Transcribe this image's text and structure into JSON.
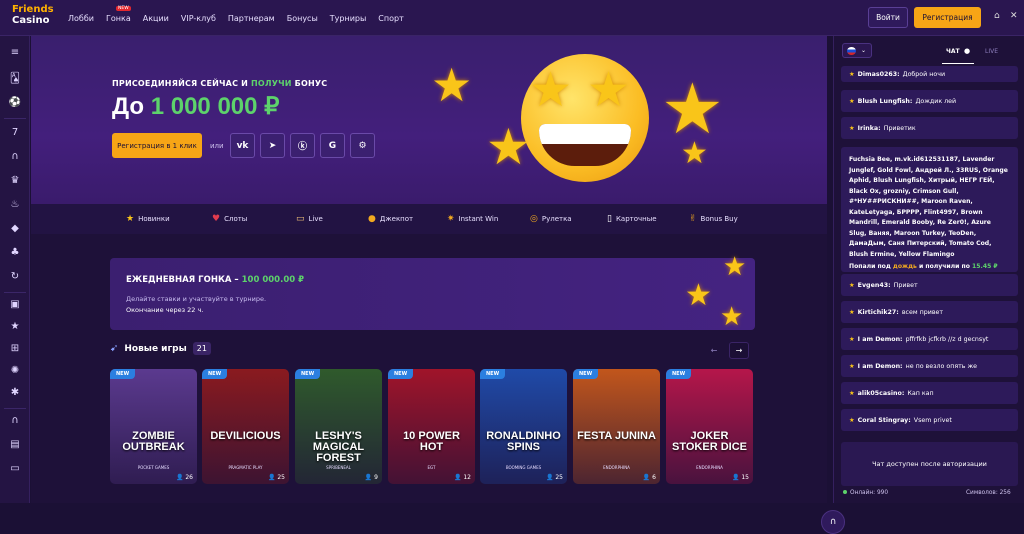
{
  "logo": {
    "line1": "Friends",
    "line2": "Casino"
  },
  "nav": {
    "items": [
      "Лобби",
      "Гонка",
      "Акции",
      "VIP-клуб",
      "Партнерам",
      "Бонусы",
      "Турниры",
      "Спорт"
    ],
    "race_badge": "NEW"
  },
  "header": {
    "login": "Войти",
    "register": "Регистрация"
  },
  "hero": {
    "sub_pre": "ПРИСОЕДИНЯЙСЯ СЕЙЧАС И ",
    "sub_green": "ПОЛУЧИ",
    "sub_post": " БОНУС",
    "title_pre": "До ",
    "amount": "1 000 000 ₽",
    "button": "Регистрация в 1 клик",
    "or": "или",
    "socials": [
      "VK",
      "TG",
      "OK",
      "G",
      "ST"
    ]
  },
  "categories": [
    {
      "icon": "star-icon",
      "label": "Новинки"
    },
    {
      "icon": "cherry-icon",
      "label": "Слоты"
    },
    {
      "icon": "live-icon",
      "label": "Live"
    },
    {
      "icon": "bag-icon",
      "label": "Джекпот"
    },
    {
      "icon": "instant-icon",
      "label": "Instant Win"
    },
    {
      "icon": "roulette-icon",
      "label": "Рулетка"
    },
    {
      "icon": "card-icon",
      "label": "Карточные"
    },
    {
      "icon": "bonus-icon",
      "label": "Bonus Buy"
    }
  ],
  "race": {
    "title_pre": "ЕЖЕДНЕВНАЯ ГОНКА – ",
    "amount": "100 000.00 ₽",
    "desc1": "Делайте ставки и участвуйте в турнире.",
    "desc2": "Окончание через 22 ч."
  },
  "new_games": {
    "title": "Новые игры",
    "count": "21",
    "badge": "NEW",
    "items": [
      {
        "title": "ZOMBIE OUTBREAK",
        "provider": "POCKET GAMES",
        "users": "26",
        "color": "#5b3a8f"
      },
      {
        "title": "DEVILICIOUS",
        "provider": "PRAGMATIC PLAY",
        "users": "25",
        "color": "#8a1a1f"
      },
      {
        "title": "LESHY'S MAGICAL FOREST",
        "provider": "SPRIBENEAL",
        "users": "9",
        "color": "#2f5a2c"
      },
      {
        "title": "10 POWER HOT",
        "provider": "EGT",
        "users": "12",
        "color": "#a0142a"
      },
      {
        "title": "RONALDINHO SPINS",
        "provider": "BOOMING GAMES",
        "users": "25",
        "color": "#1f4aa8"
      },
      {
        "title": "FESTA JUNINA",
        "provider": "ENDORPHINA",
        "users": "6",
        "color": "#c2561c"
      },
      {
        "title": "JOKER STOKER DICE",
        "provider": "ENDORPHINA",
        "users": "15",
        "color": "#b5164a"
      }
    ]
  },
  "chat": {
    "tab_chat": "ЧАТ",
    "tab_live": "LIVE",
    "messages": [
      {
        "user": "Dimas0263:",
        "text": "Доброй ночи"
      },
      {
        "user": "Blush Lungfish:",
        "text": "Дождик лей"
      },
      {
        "user": "Irinka:",
        "text": "Приветик"
      }
    ],
    "rain_text": "Fuchsia Bee, m.vk.id612531187, Lavender Junglef, Gold Fowl, Андрей Л., 33RUS, Orange Aphid, Blush Lungfish, Хитрый, НЕГР ГЕЙ, Black Ox, grozniy, Crimson Gull, #*НУ##РИСКНИ##, Maroon Raven, KateLetyaga, БРРРР, Flint4997, Brown Mandrill, Emerald Booby, Re Zer0!, Azure Slug, Ваняя, Maroon Turkey, TeoDen, ДамаДым, Саня Питерский, Tomato Cod, Blush Ermine, Yellow Flamingo",
    "rain_footer_pre": "Попали под ",
    "rain_word": "дождь",
    "rain_mid": " и получили по ",
    "rain_amount": "15.45 ₽",
    "messages2": [
      {
        "user": "Evgen43:",
        "text": "Привет"
      },
      {
        "user": "Kirtichik27:",
        "text": "всем привет"
      },
      {
        "user": "I am Demon:",
        "text": "pffrfkb jcfkrb //z d gecnsyt"
      },
      {
        "user": "I am Demon:",
        "text": "не по везло опять же"
      },
      {
        "user": "alik05casino:",
        "text": "Кап кап"
      },
      {
        "user": "Coral Stingray:",
        "text": "Vsem privet"
      }
    ],
    "locked": "Чат доступен после авторизации",
    "online_label": "Онлайн: 990",
    "chars_label": "Символов: 256"
  }
}
